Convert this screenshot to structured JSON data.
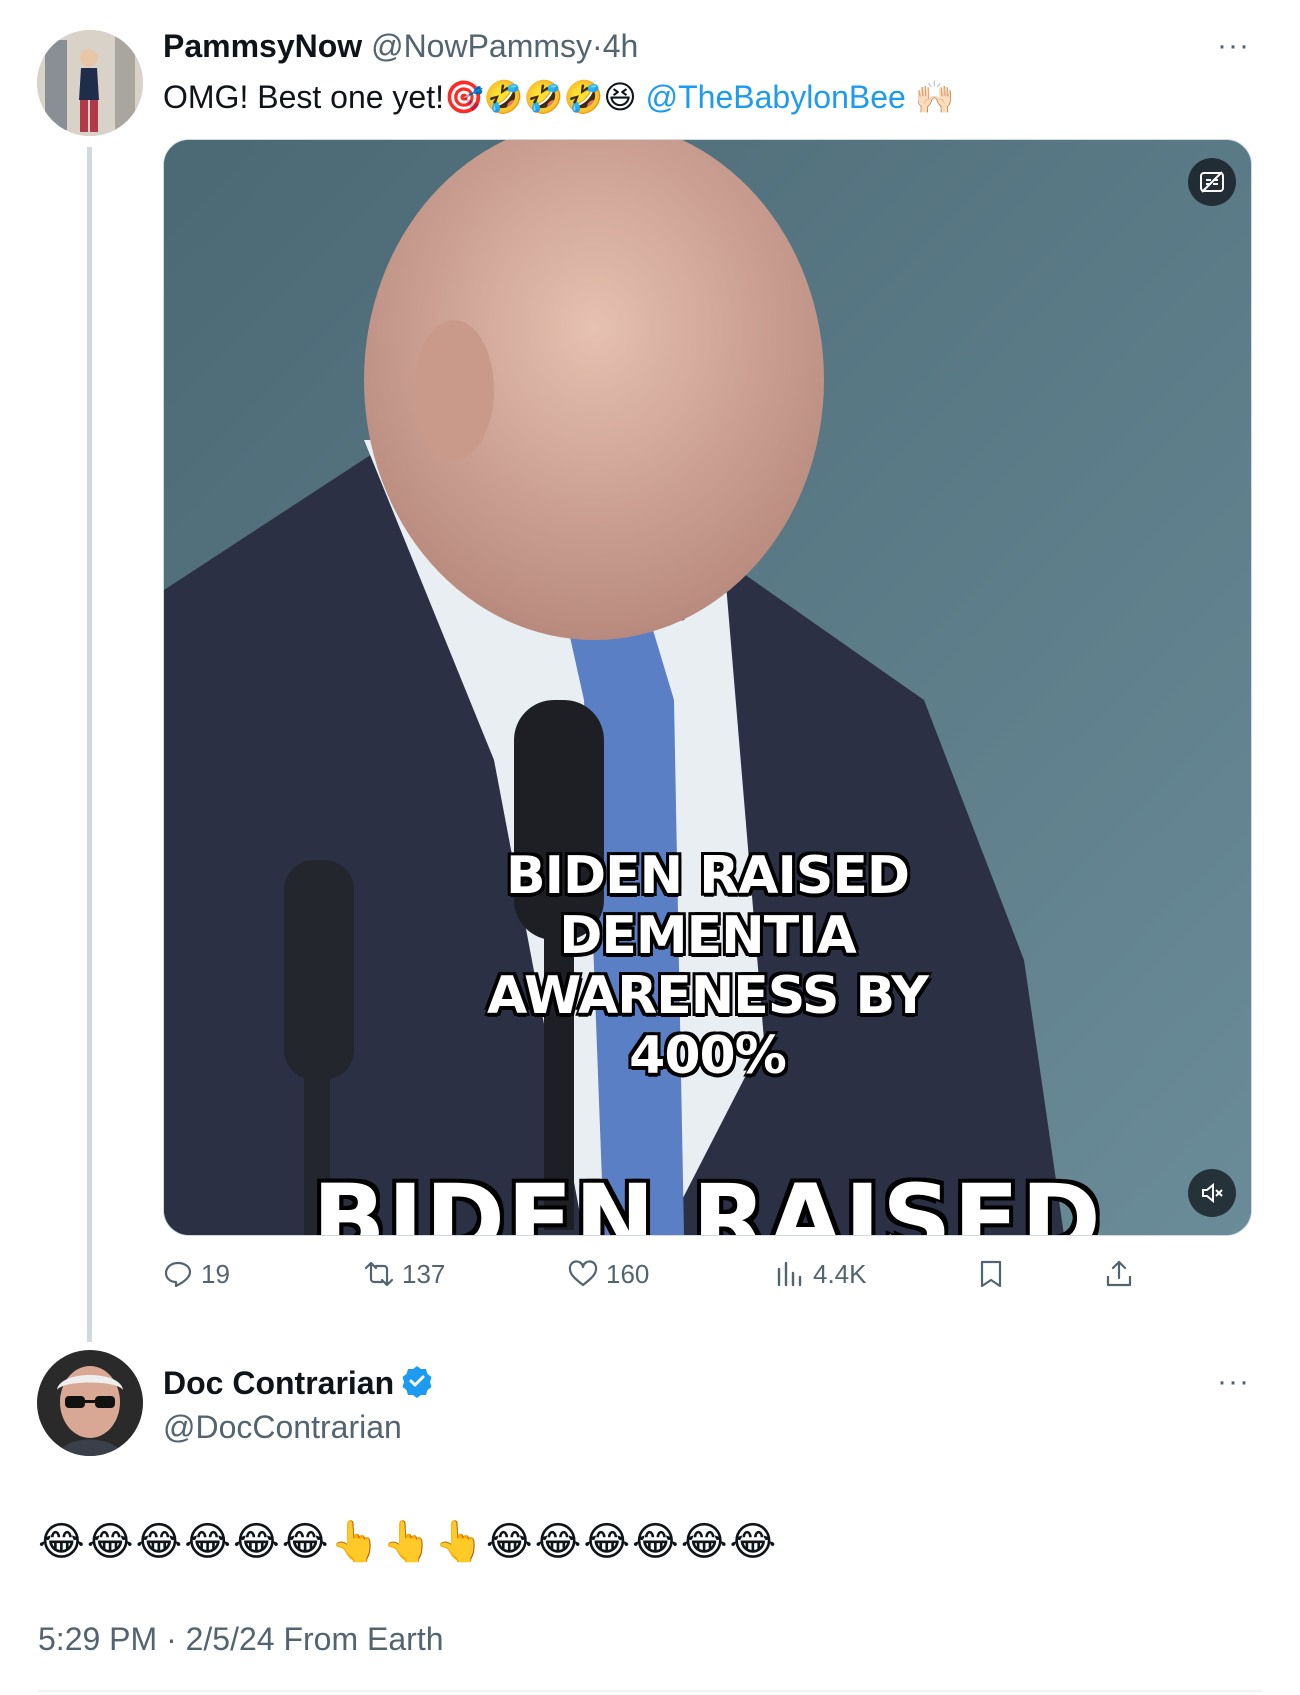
{
  "tweet1": {
    "display_name": "PammsyNow",
    "handle": "@NowPammsy",
    "separator": "·",
    "time": "4h",
    "more": "···",
    "text": "OMG! Best one yet!",
    "emojis": "🎯🤣🤣🤣😆",
    "mention": "@TheBabylonBee",
    "end_emoji": "🙌🏻",
    "media": {
      "caption": "BIDEN RAISED DEMENTIA AWARENESS BY 400%",
      "caption_bottom": "BIDEN RAISED",
      "watermark_icon": "captions-off-icon",
      "mute_icon": "mute-icon"
    },
    "actions": {
      "replies": "19",
      "reposts": "137",
      "likes": "160",
      "views": "4.4K"
    }
  },
  "tweet2": {
    "display_name": "Doc Contrarian",
    "handle": "@DocContrarian",
    "verified_color": "#1d9bf0",
    "more": "···",
    "text": "😂😂😂😂😂😂👆👆👆😂😂😂😂😂😂",
    "timestamp": "5:29 PM · 2/5/24 From Earth"
  },
  "colors": {
    "accent": "#1d9bf0",
    "muted": "#536471"
  }
}
